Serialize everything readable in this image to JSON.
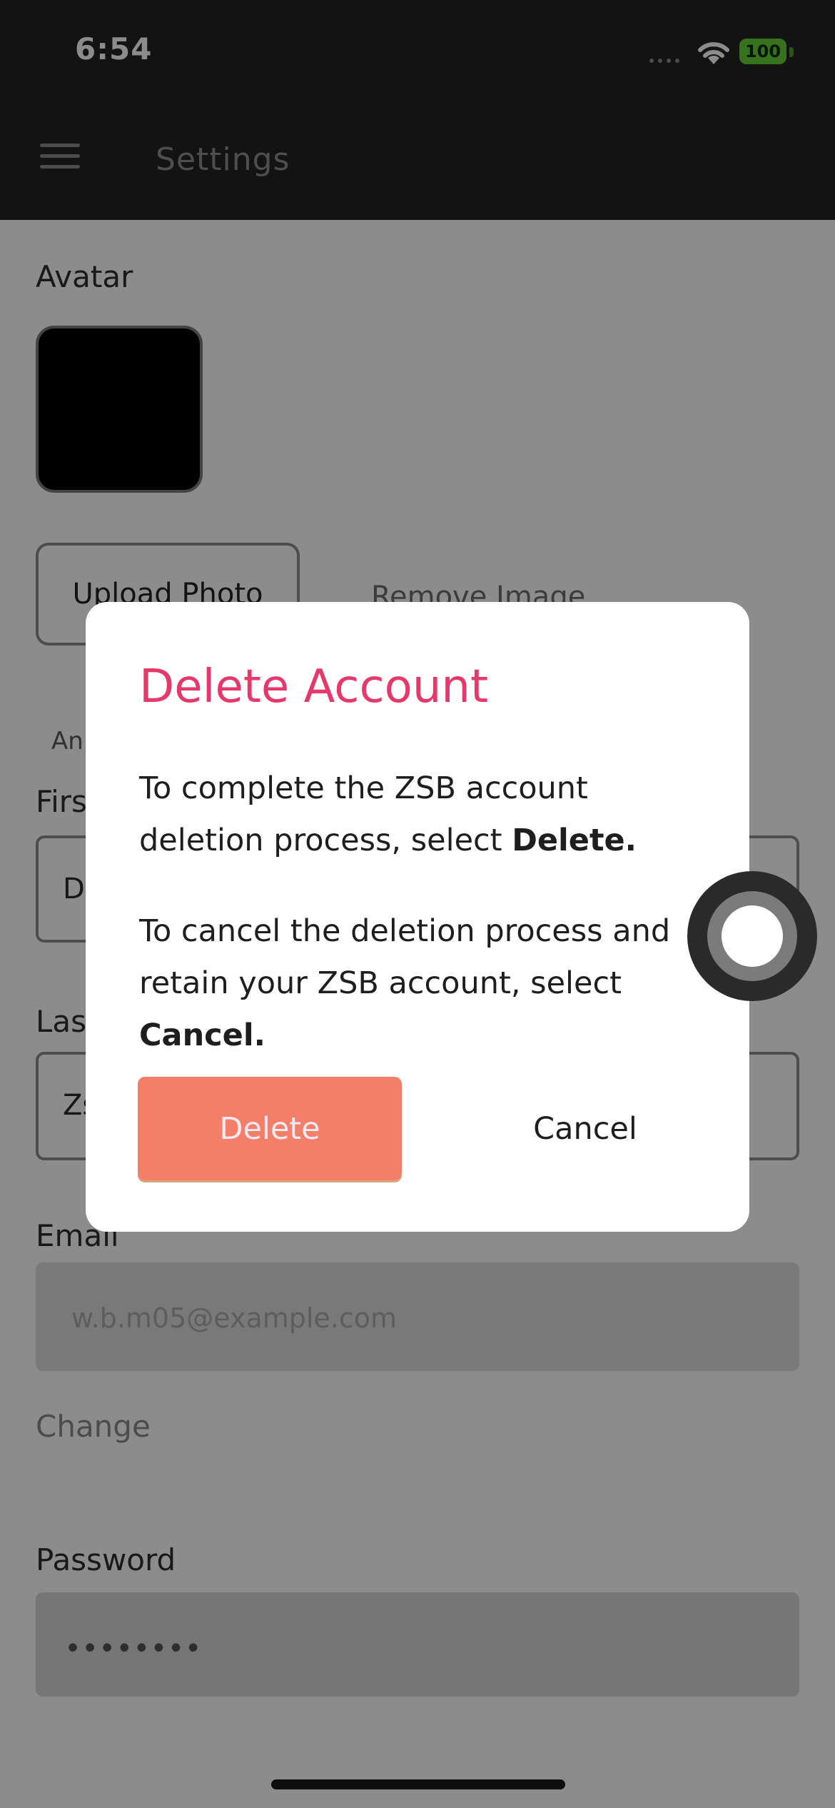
{
  "status_bar": {
    "time": "6:54",
    "battery": "100"
  },
  "header": {
    "title": "Settings"
  },
  "settings": {
    "avatar_label": "Avatar",
    "upload_photo_label": "Upload Photo",
    "remove_image_label": "Remove Image",
    "hint_text": "An",
    "first_name_label": "First",
    "first_name_value": "D",
    "last_name_label": "Las",
    "last_name_value": "Zs",
    "email_label": "Email",
    "email_value": "w.b.m05@example.com",
    "change_label": "Change",
    "password_label": "Password",
    "password_value": "••••••••"
  },
  "dialog": {
    "title": "Delete Account",
    "paragraph1_prefix": "To complete the ZSB account deletion process, select ",
    "paragraph1_bold": "Delete.",
    "paragraph2_prefix": "To cancel the deletion process and retain your ZSB account, select ",
    "paragraph2_bold": "Cancel.",
    "delete_label": "Delete",
    "cancel_label": "Cancel"
  },
  "colors": {
    "accent": "#e6396b",
    "delete_button": "#f37f68",
    "battery": "#66cf3a"
  },
  "icons": {
    "menu": "menu-icon",
    "wifi": "wifi-icon",
    "battery": "battery-icon",
    "assistive": "assistive-touch-icon"
  }
}
